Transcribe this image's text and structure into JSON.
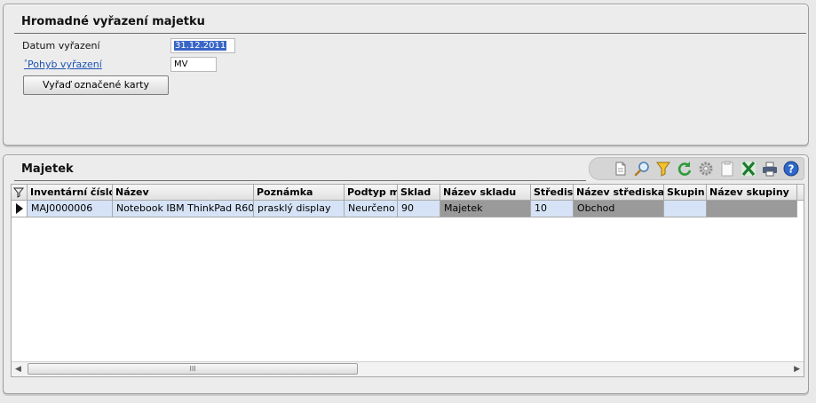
{
  "top_panel": {
    "title": "Hromadné vyřazení majetku",
    "date_label": "Datum vyřazení",
    "date_value": "31.12.2011",
    "movement_link": "Pohyb vyřazení",
    "movement_value": "MV",
    "discard_button": "Vyřaď označené karty"
  },
  "bottom_panel": {
    "title": "Majetek",
    "toolbar_icons": [
      "new-document-icon",
      "search-icon",
      "filter-icon",
      "refresh-icon",
      "settings-icon",
      "clipboard-icon",
      "excel-icon",
      "print-icon",
      "help-icon"
    ],
    "columns": [
      "Inventární číslo",
      "Název",
      "Poznámka",
      "Podtyp m",
      "Sklad",
      "Název skladu",
      "Středis",
      "Název střediska",
      "Skupin",
      "Název skupiny"
    ],
    "rows": [
      [
        "MAJ0000006",
        "Notebook IBM ThinkPad R60",
        "prasklý display",
        "Neurčeno",
        "90",
        "Majetek",
        "10",
        "Obchod",
        "",
        ""
      ]
    ],
    "scroll_grip": "III"
  },
  "colors": {
    "link": "#1c54b4",
    "selection": "#3a66c6",
    "row_highlight": "#d6e3f6",
    "readonly_cell": "#9a9a9a"
  }
}
